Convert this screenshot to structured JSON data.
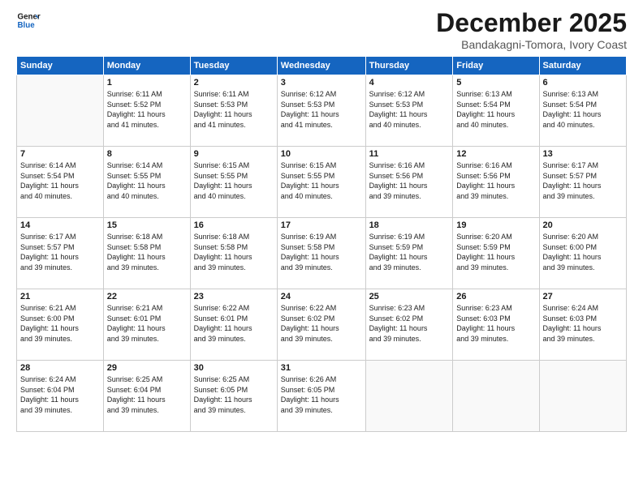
{
  "logo": {
    "line1": "General",
    "line2": "Blue"
  },
  "title": "December 2025",
  "subtitle": "Bandakagni-Tomora, Ivory Coast",
  "days": [
    "Sunday",
    "Monday",
    "Tuesday",
    "Wednesday",
    "Thursday",
    "Friday",
    "Saturday"
  ],
  "weeks": [
    [
      {
        "day": "",
        "info": ""
      },
      {
        "day": "1",
        "info": "Sunrise: 6:11 AM\nSunset: 5:52 PM\nDaylight: 11 hours\nand 41 minutes."
      },
      {
        "day": "2",
        "info": "Sunrise: 6:11 AM\nSunset: 5:53 PM\nDaylight: 11 hours\nand 41 minutes."
      },
      {
        "day": "3",
        "info": "Sunrise: 6:12 AM\nSunset: 5:53 PM\nDaylight: 11 hours\nand 41 minutes."
      },
      {
        "day": "4",
        "info": "Sunrise: 6:12 AM\nSunset: 5:53 PM\nDaylight: 11 hours\nand 40 minutes."
      },
      {
        "day": "5",
        "info": "Sunrise: 6:13 AM\nSunset: 5:54 PM\nDaylight: 11 hours\nand 40 minutes."
      },
      {
        "day": "6",
        "info": "Sunrise: 6:13 AM\nSunset: 5:54 PM\nDaylight: 11 hours\nand 40 minutes."
      }
    ],
    [
      {
        "day": "7",
        "info": "Sunrise: 6:14 AM\nSunset: 5:54 PM\nDaylight: 11 hours\nand 40 minutes."
      },
      {
        "day": "8",
        "info": "Sunrise: 6:14 AM\nSunset: 5:55 PM\nDaylight: 11 hours\nand 40 minutes."
      },
      {
        "day": "9",
        "info": "Sunrise: 6:15 AM\nSunset: 5:55 PM\nDaylight: 11 hours\nand 40 minutes."
      },
      {
        "day": "10",
        "info": "Sunrise: 6:15 AM\nSunset: 5:55 PM\nDaylight: 11 hours\nand 40 minutes."
      },
      {
        "day": "11",
        "info": "Sunrise: 6:16 AM\nSunset: 5:56 PM\nDaylight: 11 hours\nand 39 minutes."
      },
      {
        "day": "12",
        "info": "Sunrise: 6:16 AM\nSunset: 5:56 PM\nDaylight: 11 hours\nand 39 minutes."
      },
      {
        "day": "13",
        "info": "Sunrise: 6:17 AM\nSunset: 5:57 PM\nDaylight: 11 hours\nand 39 minutes."
      }
    ],
    [
      {
        "day": "14",
        "info": "Sunrise: 6:17 AM\nSunset: 5:57 PM\nDaylight: 11 hours\nand 39 minutes."
      },
      {
        "day": "15",
        "info": "Sunrise: 6:18 AM\nSunset: 5:58 PM\nDaylight: 11 hours\nand 39 minutes."
      },
      {
        "day": "16",
        "info": "Sunrise: 6:18 AM\nSunset: 5:58 PM\nDaylight: 11 hours\nand 39 minutes."
      },
      {
        "day": "17",
        "info": "Sunrise: 6:19 AM\nSunset: 5:58 PM\nDaylight: 11 hours\nand 39 minutes."
      },
      {
        "day": "18",
        "info": "Sunrise: 6:19 AM\nSunset: 5:59 PM\nDaylight: 11 hours\nand 39 minutes."
      },
      {
        "day": "19",
        "info": "Sunrise: 6:20 AM\nSunset: 5:59 PM\nDaylight: 11 hours\nand 39 minutes."
      },
      {
        "day": "20",
        "info": "Sunrise: 6:20 AM\nSunset: 6:00 PM\nDaylight: 11 hours\nand 39 minutes."
      }
    ],
    [
      {
        "day": "21",
        "info": "Sunrise: 6:21 AM\nSunset: 6:00 PM\nDaylight: 11 hours\nand 39 minutes."
      },
      {
        "day": "22",
        "info": "Sunrise: 6:21 AM\nSunset: 6:01 PM\nDaylight: 11 hours\nand 39 minutes."
      },
      {
        "day": "23",
        "info": "Sunrise: 6:22 AM\nSunset: 6:01 PM\nDaylight: 11 hours\nand 39 minutes."
      },
      {
        "day": "24",
        "info": "Sunrise: 6:22 AM\nSunset: 6:02 PM\nDaylight: 11 hours\nand 39 minutes."
      },
      {
        "day": "25",
        "info": "Sunrise: 6:23 AM\nSunset: 6:02 PM\nDaylight: 11 hours\nand 39 minutes."
      },
      {
        "day": "26",
        "info": "Sunrise: 6:23 AM\nSunset: 6:03 PM\nDaylight: 11 hours\nand 39 minutes."
      },
      {
        "day": "27",
        "info": "Sunrise: 6:24 AM\nSunset: 6:03 PM\nDaylight: 11 hours\nand 39 minutes."
      }
    ],
    [
      {
        "day": "28",
        "info": "Sunrise: 6:24 AM\nSunset: 6:04 PM\nDaylight: 11 hours\nand 39 minutes."
      },
      {
        "day": "29",
        "info": "Sunrise: 6:25 AM\nSunset: 6:04 PM\nDaylight: 11 hours\nand 39 minutes."
      },
      {
        "day": "30",
        "info": "Sunrise: 6:25 AM\nSunset: 6:05 PM\nDaylight: 11 hours\nand 39 minutes."
      },
      {
        "day": "31",
        "info": "Sunrise: 6:26 AM\nSunset: 6:05 PM\nDaylight: 11 hours\nand 39 minutes."
      },
      {
        "day": "",
        "info": ""
      },
      {
        "day": "",
        "info": ""
      },
      {
        "day": "",
        "info": ""
      }
    ]
  ]
}
